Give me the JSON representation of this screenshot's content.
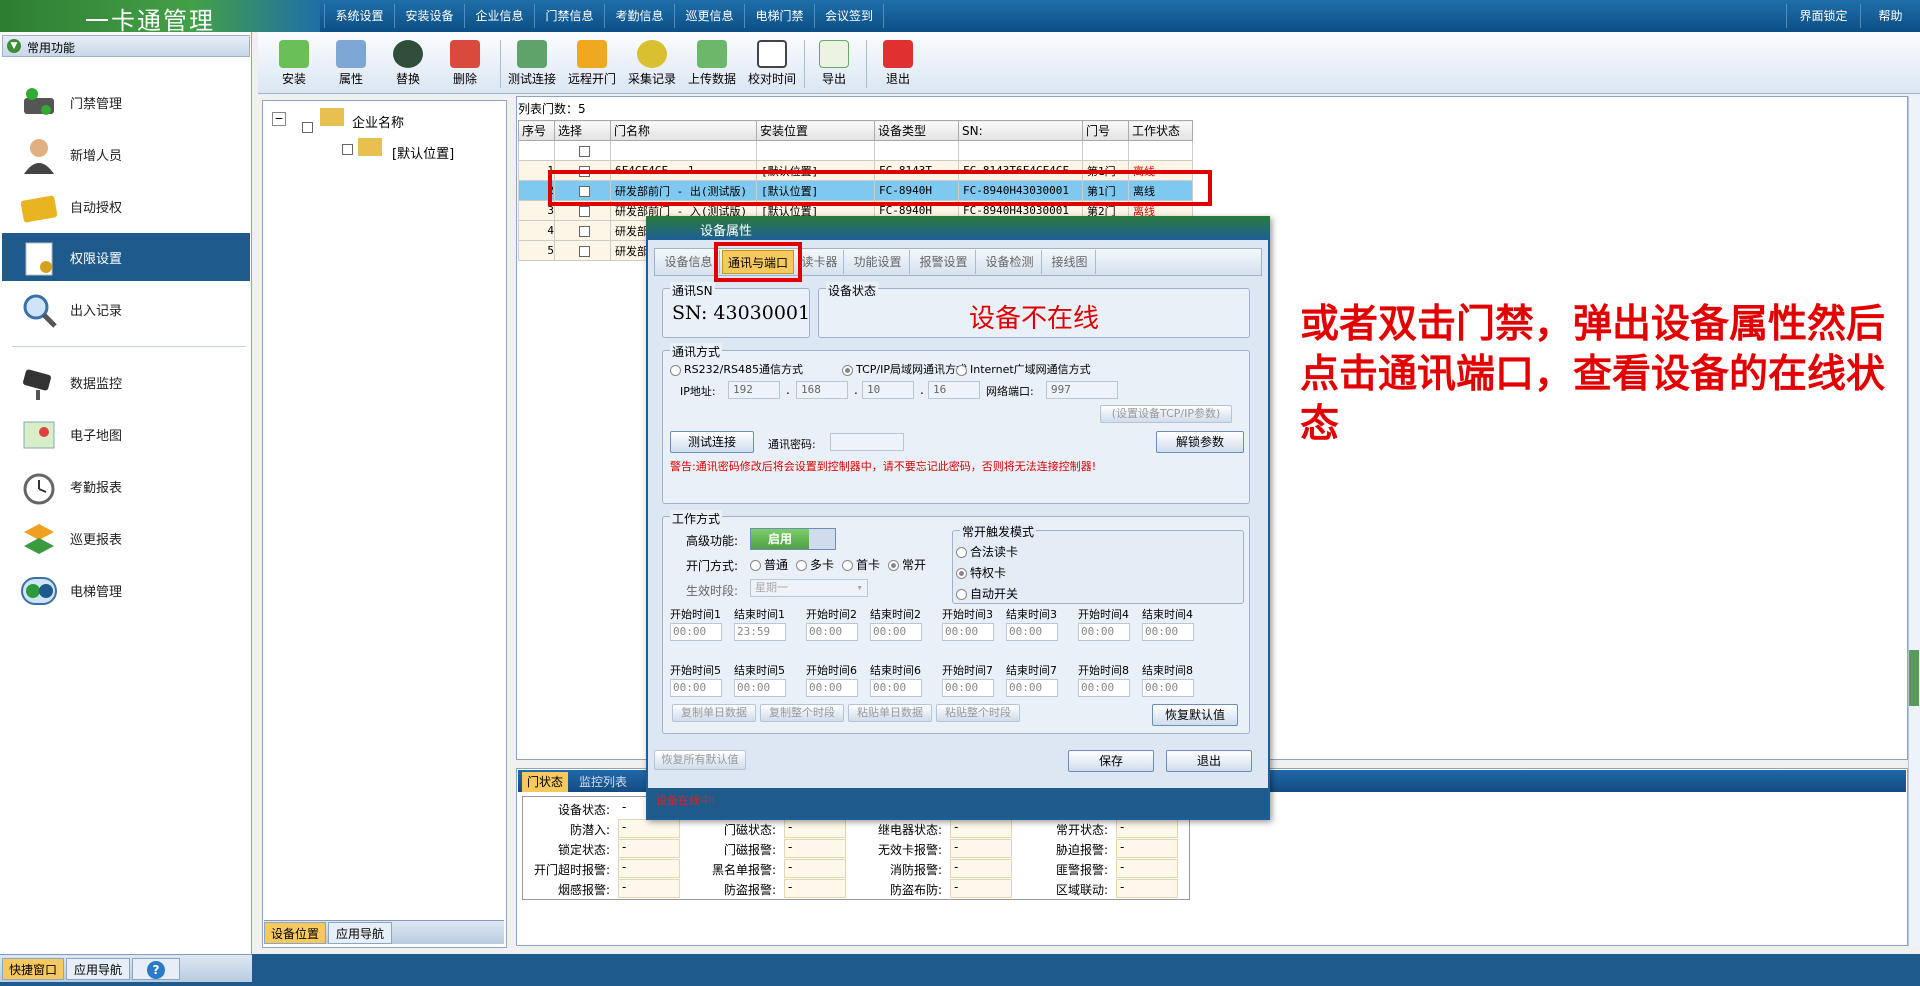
{
  "app": {
    "title": "一卡通管理"
  },
  "top_menu": [
    "系统设置",
    "安装设备",
    "企业信息",
    "门禁信息",
    "考勤信息",
    "巡更信息",
    "电梯门禁",
    "会议签到"
  ],
  "top_right": [
    "界面锁定",
    "帮助"
  ],
  "left": {
    "header": "常用功能",
    "items": [
      "门禁管理",
      "新增人员",
      "自动授权",
      "权限设置",
      "出入记录",
      "数据监控",
      "电子地图",
      "考勤报表",
      "巡更报表",
      "电梯管理"
    ],
    "active": "权限设置",
    "bottom_tabs": [
      "快捷窗口",
      "应用导航"
    ]
  },
  "toolbar": [
    "安装",
    "属性",
    "替换",
    "删除",
    "测试连接",
    "远程开门",
    "采集记录",
    "上传数据",
    "校对时间",
    "导出",
    "退出"
  ],
  "tree": {
    "root": "企业名称",
    "child": "[默认位置]",
    "tabs": [
      "设备位置",
      "应用导航"
    ]
  },
  "list": {
    "count_label": "列表门数：5",
    "headers": [
      "序号",
      "选择",
      "门名称",
      "安装位置",
      "设备类型",
      "SN:",
      "门号",
      "工作状态"
    ],
    "rows": [
      {
        "no": "1",
        "name": "6F4CF4CF...1",
        "loc": "[默认位置]",
        "type": "FC-8143T",
        "sn": "FC-8143T6F4CF4CF",
        "door": "第1门",
        "status": "离线"
      },
      {
        "no": "2",
        "name": "研发部前门 - 出(测试版)",
        "loc": "[默认位置]",
        "type": "FC-8940H",
        "sn": "FC-8940H43030001",
        "door": "第1门",
        "status": "离线"
      },
      {
        "no": "3",
        "name": "研发部前门 - 入(测试版)",
        "loc": "[默认位置]",
        "type": "FC-8940H",
        "sn": "FC-8940H43030001",
        "door": "第2门",
        "status": "离线"
      },
      {
        "no": "4",
        "name": "研发部",
        "loc": "",
        "type": "",
        "sn": "",
        "door": "",
        "status": ""
      },
      {
        "no": "5",
        "name": "研发部",
        "loc": "",
        "type": "",
        "sn": "",
        "door": "",
        "status": ""
      }
    ]
  },
  "status_panel": {
    "tabs": [
      "门状态",
      "监控列表"
    ],
    "fields": [
      [
        "设备状态:",
        "-",
        "",
        "",
        "",
        "",
        "",
        ""
      ],
      [
        "防潜入:",
        "-",
        "门磁状态:",
        "-",
        "继电器状态:",
        "-",
        "常开状态:",
        "-"
      ],
      [
        "锁定状态:",
        "-",
        "门磁报警:",
        "-",
        "无效卡报警:",
        "-",
        "胁迫报警:",
        "-"
      ],
      [
        "开门超时报警:",
        "-",
        "黑名单报警:",
        "-",
        "消防报警:",
        "-",
        "匪警报警:",
        "-"
      ],
      [
        "烟感报警:",
        "-",
        "防盗报警:",
        "-",
        "防盗布防:",
        "-",
        "区域联动:",
        "-"
      ]
    ]
  },
  "dialog": {
    "title": "设备属性",
    "tabs": [
      "设备信息",
      "通讯与端口",
      "读卡器",
      "功能设置",
      "报警设置",
      "设备检测",
      "接线图"
    ],
    "active_tab": "通讯与端口",
    "sn_group": "通讯SN",
    "sn_value": "SN: 43030001",
    "state_group": "设备状态",
    "state_value": "设备不在线",
    "comm_group": "通讯方式",
    "comm_options": [
      "RS232/RS485通信方式",
      "TCP/IP局域网通讯方式",
      "Internet广域网通信方式"
    ],
    "ip_label": "IP地址:",
    "ip": [
      "192",
      "168",
      "10",
      "16"
    ],
    "port_label": "网络端口:",
    "port": "997",
    "set_tcp_button": "(设置设备TCP/IP参数)",
    "test_button": "测试连接",
    "pwd_label": "通讯密码:",
    "unlock_button": "解锁参数",
    "warning": "警告:通讯密码修改后将会设置到控制器中，请不要忘记此密码，否则将无法连接控制器!",
    "work_group": "工作方式",
    "adv_label": "高级功能:",
    "adv_value": "启用",
    "open_label": "开门方式:",
    "open_options": [
      "普通",
      "多卡",
      "首卡",
      "常开"
    ],
    "period_label": "生效时段:",
    "period_value": "星期一",
    "trigger_group": "常开触发模式",
    "trigger_options": [
      "合法读卡",
      "特权卡",
      "自动开关"
    ],
    "time_labels_1": [
      "开始时间1",
      "结束时间1",
      "开始时间2",
      "结束时间2",
      "开始时间3",
      "结束时间3",
      "开始时间4",
      "结束时间4"
    ],
    "time_values_1": [
      "00:00",
      "23:59",
      "00:00",
      "00:00",
      "00:00",
      "00:00",
      "00:00",
      "00:00"
    ],
    "time_labels_2": [
      "开始时间5",
      "结束时间5",
      "开始时间6",
      "结束时间6",
      "开始时间7",
      "结束时间7",
      "开始时间8",
      "结束时间8"
    ],
    "time_values_2": [
      "00:00",
      "00:00",
      "00:00",
      "00:00",
      "00:00",
      "00:00",
      "00:00",
      "00:00"
    ],
    "copy_buttons": [
      "复制单日数据",
      "复制整个时段",
      "粘贴单日数据",
      "粘贴整个时段"
    ],
    "restore_default": "恢复默认值",
    "restore_all": "恢复所有默认值",
    "save": "保存",
    "exit": "退出",
    "status_bar": "设备在线中!"
  },
  "annotation": "或者双击门禁，弹出设备属性然后点击通讯端口，查看设备的在线状态",
  "colors": {
    "accent": "#1f5a8c",
    "highlight": "#e00000",
    "selected_row": "#7fc8ef"
  }
}
